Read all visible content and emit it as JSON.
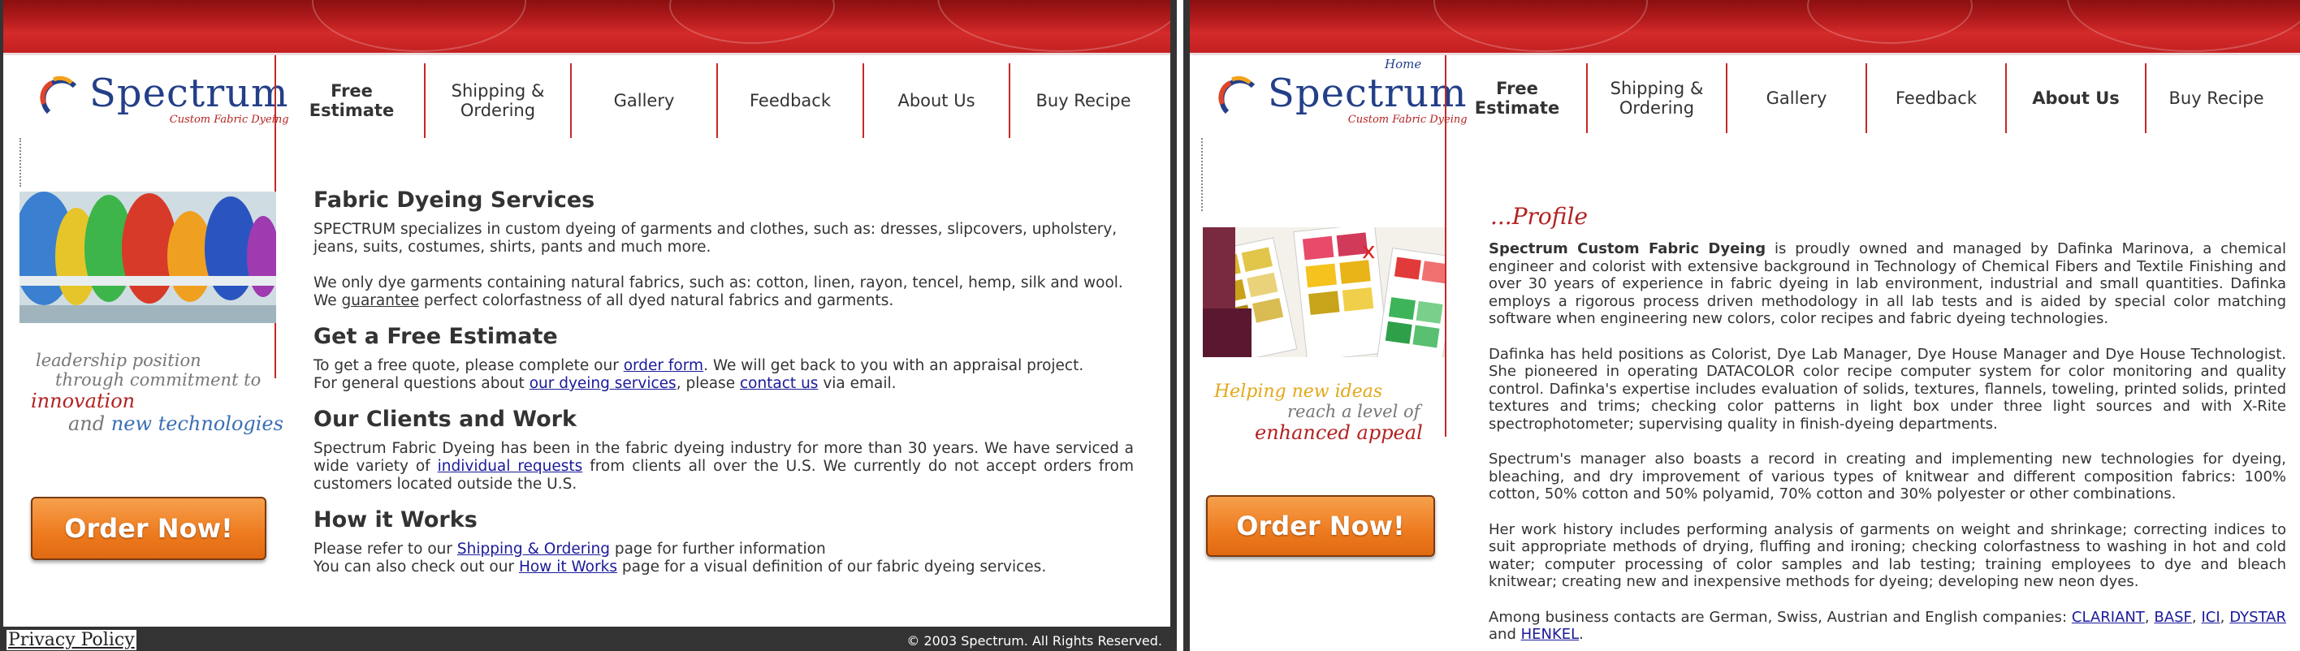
{
  "left": {
    "logo": {
      "name": "Spectrum",
      "tagline": "Custom Fabric Dyeing"
    },
    "nav": [
      {
        "label": "Free\nEstimate",
        "bold": true
      },
      {
        "label": "Shipping &\nOrdering",
        "bold": false
      },
      {
        "label": "Gallery",
        "bold": false
      },
      {
        "label": "Feedback",
        "bold": false
      },
      {
        "label": "About Us",
        "bold": false
      },
      {
        "label": "Buy Recipe",
        "bold": false
      }
    ],
    "slogan": {
      "line1": "leadership position",
      "line2": "through commitment to",
      "line3": "innovation",
      "line4a": "and",
      "line4b": "new technologies"
    },
    "order_button": "Order Now!",
    "sections": {
      "services_title": "Fabric Dyeing Services",
      "services_p1": "SPECTRUM specializes in custom dyeing of garments and clothes, such as: dresses, slipcovers, upholstery, jeans, suits, costumes, shirts, pants and much more.",
      "services_p2a": "We only dye garments containing natural fabrics, such as: cotton, linen, rayon, tencel, hemp, silk and wool.",
      "services_p2b_pre": "We ",
      "services_p2b_link": "guarantee",
      "services_p2b_post": " perfect colorfastness of all dyed natural fabrics and garments.",
      "estimate_title": "Get a Free Estimate",
      "estimate_l1_pre": "To get a free quote, please complete our ",
      "estimate_l1_link": "order form",
      "estimate_l1_post": ". We will get back to you with an appraisal project.",
      "estimate_l2_pre": "For general questions about ",
      "estimate_l2_link1": "our dyeing services",
      "estimate_l2_mid": ", please ",
      "estimate_l2_link2": "contact us",
      "estimate_l2_post": " via email.",
      "clients_title": "Our Clients and Work",
      "clients_pre": "Spectrum Fabric Dyeing has been in the fabric dyeing industry for more than 30 years.  We have serviced a wide variety of ",
      "clients_link": "individual requests",
      "clients_post": " from clients all over the U.S.  We currently do not accept orders from customers located outside the U.S.",
      "how_title": "How it Works",
      "how_l1_pre": "Please refer to our ",
      "how_l1_link": "Shipping & Ordering",
      "how_l1_post": " page for further information",
      "how_l2_pre": "You can also check out our ",
      "how_l2_link": "How it Works",
      "how_l2_post": " page for a visual definition of our fabric dyeing services."
    },
    "footer": {
      "privacy": "Privacy Policy",
      "copyright": "© 2003 Spectrum. All Rights Reserved."
    }
  },
  "right": {
    "home": "Home",
    "logo": {
      "name": "Spectrum",
      "tagline": "Custom Fabric Dyeing"
    },
    "nav": [
      {
        "label": "Free\nEstimate",
        "bold": true
      },
      {
        "label": "Shipping &\nOrdering",
        "bold": false
      },
      {
        "label": "Gallery",
        "bold": false
      },
      {
        "label": "Feedback",
        "bold": false
      },
      {
        "label": "About Us",
        "bold": true
      },
      {
        "label": "Buy Recipe",
        "bold": false
      }
    ],
    "slogan": {
      "line1": "Helping new ideas",
      "line2": "reach a level of",
      "line3": "enhanced appeal"
    },
    "order_button": "Order Now!",
    "profile_title_dots": "...",
    "profile_title": "Profile",
    "p1_bold": "Spectrum Custom Fabric Dyeing",
    "p1_rest": " is proudly owned and managed by Dafinka Marinova, a chemical engineer and colorist with extensive background in Technology of Chemical Fibers and Textile Finishing and over 30 years of experience in fabric dyeing in lab environment, industrial and small quantities. Dafinka employs a rigorous process driven methodology in all lab tests and is aided by special color matching software when engineering new colors, color recipes and fabric dyeing technologies.",
    "p2": "Dafinka has held positions as Colorist, Dye Lab Manager, Dye House Manager and Dye House Technologist. She pioneered in operating DATACOLOR color recipe computer system for color monitoring and quality control. Dafinka's expertise includes evaluation of solids, textures, flannels, toweling, printed solids, printed textures and trims; checking color patterns in light box under three light sources and with X-Rite spectrophotometer; supervising quality in finish-dyeing departments.",
    "p3": "Spectrum's manager also boasts a record in creating and implementing new technologies for dyeing, bleaching, and dry improvement of various types of knitwear and different composition fabrics: 100% cotton, 50% cotton and 50% polyamid, 70% cotton and 30% polyester or other combinations.",
    "p4": "Her work history includes performing analysis of garments on weight and shrinkage; correcting indices to suit appropriate methods of drying, fluffing and ironing; checking colorfastness to washing in hot and cold water; computer processing of color samples and lab testing; training employees to dye and bleach knitwear; creating new and inexpensive methods for dyeing; developing new neon dyes.",
    "p5_pre": "Among business contacts are German, Swiss, Austrian and English companies: ",
    "p5_links": [
      "CLARIANT",
      "BASF",
      "ICI",
      "DYSTAR",
      "HENKEL"
    ],
    "p5_and": " and ",
    "p5_end": "."
  }
}
